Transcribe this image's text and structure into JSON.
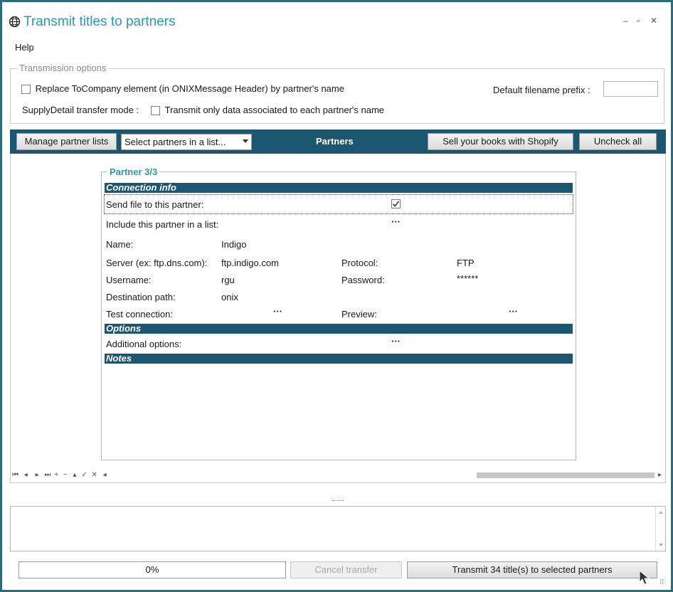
{
  "window": {
    "title": "Transmit titles to partners",
    "icon": "globe-icon",
    "controls": {
      "minimize": "‒",
      "maximize": "▫",
      "close": "✕"
    }
  },
  "menu": {
    "items": [
      "Help"
    ]
  },
  "transmission_options": {
    "legend": "Transmission options",
    "replace_to_company_label": "Replace ToCompany element (in ONIXMessage Header) by partner's name",
    "replace_to_company_checked": false,
    "supply_detail_mode_label": "SupplyDetail transfer mode :",
    "transmit_only_label": "Transmit only data associated to each partner's name",
    "transmit_only_checked": false,
    "filename_prefix_label": "Default filename prefix :",
    "filename_prefix_value": ""
  },
  "partner_toolbar": {
    "manage_lists_label": "Manage partner lists",
    "select_partners_value": "Select partners in a list...",
    "title": "Partners",
    "shopify_label": "Sell your books with Shopify",
    "uncheck_all_label": "Uncheck all"
  },
  "partner": {
    "legend": "Partner 3/3",
    "sections": {
      "connection": "Connection info",
      "options": "Options",
      "notes": "Notes"
    },
    "send_file_label": "Send file to this partner:",
    "send_file_checked": true,
    "include_list_label": "Include this partner in a list:",
    "name_label": "Name:",
    "name_value": "Indigo",
    "server_label": "Server (ex: ftp.dns.com):",
    "server_value": "ftp.indigo.com",
    "protocol_label": "Protocol:",
    "protocol_value": "FTP",
    "username_label": "Username:",
    "username_value": "rgu",
    "password_label": "Password:",
    "password_value": "******",
    "destination_label": "Destination path:",
    "destination_value": "onix",
    "test_connection_label": "Test connection:",
    "preview_label": "Preview:",
    "additional_options_label": "Additional options:",
    "ellipsis": "···"
  },
  "navigator": {
    "first": "⏮",
    "prev": "◂",
    "next": "▸",
    "last": "⏭",
    "add": "+",
    "delete": "−",
    "up": "▴",
    "confirm": "✓",
    "cancel": "✕",
    "scroll_left": "◂",
    "scroll_right": "▸"
  },
  "footer": {
    "progress_text": "0%",
    "progress_value": 0,
    "cancel_label": "Cancel transfer",
    "transmit_label": "Transmit 34 title(s) to selected partners"
  }
}
